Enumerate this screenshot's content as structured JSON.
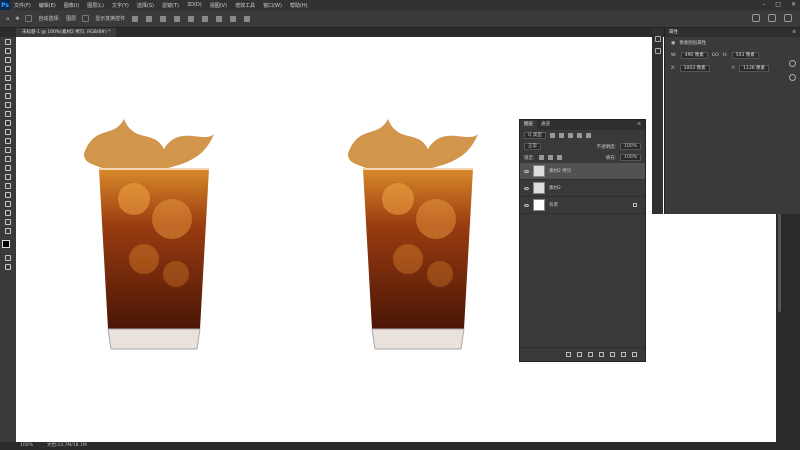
{
  "app": {
    "logo": "Ps"
  },
  "menubar": {
    "items": [
      "文件(F)",
      "编辑(E)",
      "图像(I)",
      "图层(L)",
      "文字(Y)",
      "选择(S)",
      "滤镜(T)",
      "3D(D)",
      "视图(V)",
      "增效工具",
      "窗口(W)",
      "帮助(H)"
    ]
  },
  "options": {
    "auto_select_label": "自动选择:",
    "auto_select_value": "图层",
    "show_transform_label": "显示变换控件"
  },
  "document": {
    "tab_label": "未标题-1 @ 100%(素材2 拷贝, RGB/8#) *"
  },
  "properties": {
    "header": "属性",
    "subheader": "像素图层属性",
    "w_label": "W:",
    "w_value": "490 像素",
    "h_label": "H:",
    "h_value": "503 像素",
    "link_label": "GO",
    "x_label": "X:",
    "x_value": "1003 像素",
    "y_label": "Y:",
    "y_value": "1136 像素"
  },
  "layers_panel": {
    "tab_layers": "图层",
    "tab_channels": "通道",
    "filter_kind": "Q 类型",
    "blend_mode": "正常",
    "opacity_label": "不透明度:",
    "opacity_value": "100%",
    "lock_label": "锁定:",
    "fill_label": "填充:",
    "fill_value": "100%",
    "layers": [
      {
        "name": "素材2 拷贝",
        "selected": true
      },
      {
        "name": "素材2",
        "selected": false
      },
      {
        "name": "背景",
        "selected": false
      }
    ]
  },
  "status": {
    "zoom": "100%",
    "doc_size": "文档:23.7M/18.1M"
  },
  "colors": {
    "canvas_bg": "#ffffff",
    "panel_bg": "#393939",
    "accent": "#31a8ff"
  }
}
